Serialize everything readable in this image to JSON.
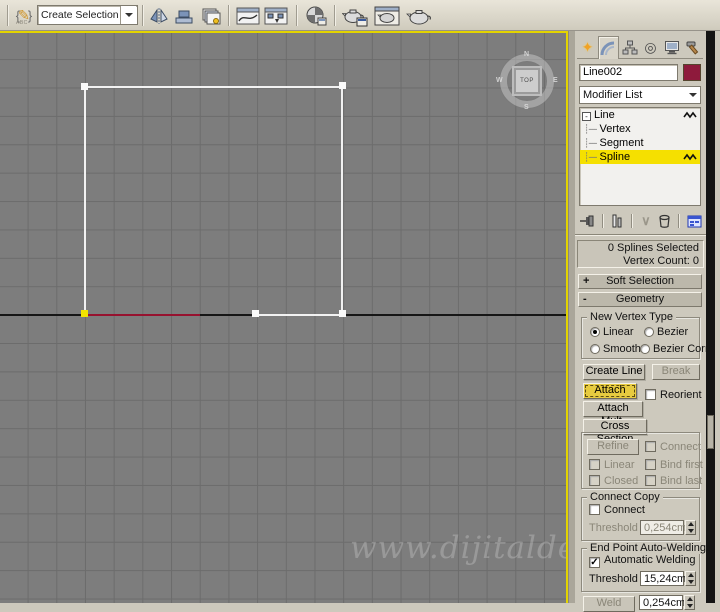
{
  "toolbar": {
    "selection_set_value": "Create Selection Se",
    "selection_sets_abc": "ABC",
    "icons": [
      "named-selection-sets",
      "mirror",
      "align",
      "layer-manager",
      "curve-editor",
      "schematic-view",
      "material-editor",
      "render-setup",
      "rendered-frame-window",
      "render-production"
    ]
  },
  "viewport": {
    "viewcube": {
      "face": "TOP",
      "north": "N",
      "south": "S",
      "west": "W",
      "east": "E"
    },
    "watermark": "www.dijitalde",
    "colors": {
      "background": "#7d7d7d",
      "grid": "#6c6c6c",
      "axis": "#161616",
      "spline": "#f2f2f2",
      "spline_red": "#97122f",
      "selected_vertex": "#f2e400",
      "active_border": "#e3d400"
    }
  },
  "command_panel": {
    "tabs": [
      "create",
      "modify",
      "hierarchy",
      "motion",
      "display",
      "utilities"
    ],
    "active_tab": "modify",
    "object_name": "Line002",
    "object_color": "#8e1a3c",
    "modifier_list_label": "Modifier List",
    "stack": {
      "items": [
        {
          "label": "Line",
          "expand": "-",
          "selected": false
        },
        {
          "label": "Vertex",
          "selected": false
        },
        {
          "label": "Segment",
          "selected": false
        },
        {
          "label": "Spline",
          "selected": true
        }
      ]
    },
    "status": {
      "line1": "0 Splines Selected",
      "line2": "Vertex Count: 0"
    },
    "rollouts": {
      "soft_selection": {
        "sign": "+",
        "label": "Soft Selection"
      },
      "geometry": {
        "sign": "-",
        "label": "Geometry"
      }
    },
    "geometry": {
      "new_vertex_type": {
        "legend": "New Vertex Type",
        "options": [
          "Linear",
          "Bezier",
          "Smooth",
          "Bezier Corner"
        ],
        "selected": "Linear"
      },
      "buttons": {
        "create_line": "Create Line",
        "break": "Break",
        "attach": "Attach",
        "attach_mult": "Attach Mult.",
        "cross_section": "Cross Section",
        "refine": "Refine",
        "weld": "Weld"
      },
      "checkboxes": {
        "reorient": "Reorient",
        "connect": "Connect",
        "linear": "Linear",
        "bind_first": "Bind first",
        "closed": "Closed",
        "bind_last": "Bind last",
        "connect_copy_connect": "Connect",
        "automatic_welding": "Automatic Welding"
      },
      "groups": {
        "connect_copy": "Connect Copy",
        "end_point_auto_welding": "End Point Auto-Welding"
      },
      "threshold_label": "Threshold",
      "values": {
        "connect_copy_threshold": "0,254cm",
        "auto_weld_threshold": "15,24cm",
        "weld_threshold": "0,254cm"
      }
    }
  }
}
